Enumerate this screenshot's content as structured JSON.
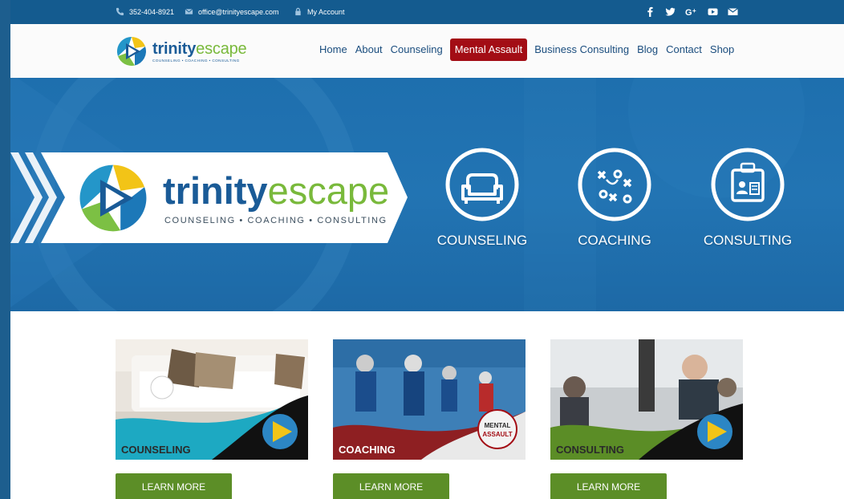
{
  "topbar": {
    "phone": "352-404-8921",
    "email": "office@trinityescape.com",
    "account": "My Account",
    "social": [
      "facebook-icon",
      "twitter-icon",
      "google-plus-icon",
      "youtube-icon",
      "envelope-icon"
    ]
  },
  "header": {
    "logo_word_a": "trinity",
    "logo_word_b": "escape",
    "logo_tagline": "COUNSELING • COACHING • CONSULTING"
  },
  "nav": [
    {
      "label": "Home"
    },
    {
      "label": "About"
    },
    {
      "label": "Counseling"
    },
    {
      "label": "Mental Assault",
      "active": true
    },
    {
      "label": "Business Consulting"
    },
    {
      "label": "Blog"
    },
    {
      "label": "Contact"
    },
    {
      "label": "Shop"
    }
  ],
  "hero": {
    "logo_word_a": "trinity",
    "logo_word_b": "escape",
    "tagline": "COUNSELING • COACHING • CONSULTING",
    "services": [
      {
        "label": "COUNSELING",
        "icon": "couch-icon"
      },
      {
        "label": "COACHING",
        "icon": "playbook-icon"
      },
      {
        "label": "CONSULTING",
        "icon": "presentation-icon"
      }
    ]
  },
  "cards": [
    {
      "caption": "COUNSELING",
      "button": "LEARN MORE"
    },
    {
      "caption": "COACHING",
      "badge": "MENTAL ASSAULT",
      "button": "LEARN MORE"
    },
    {
      "caption": "CONSULTING",
      "button": "LEARN MORE"
    }
  ],
  "colors": {
    "brand_blue": "#1a5b97",
    "brand_green": "#79b93b",
    "hero_blue": "#2274b3",
    "nav_active": "#a30d15",
    "button_green": "#5c8e27"
  }
}
